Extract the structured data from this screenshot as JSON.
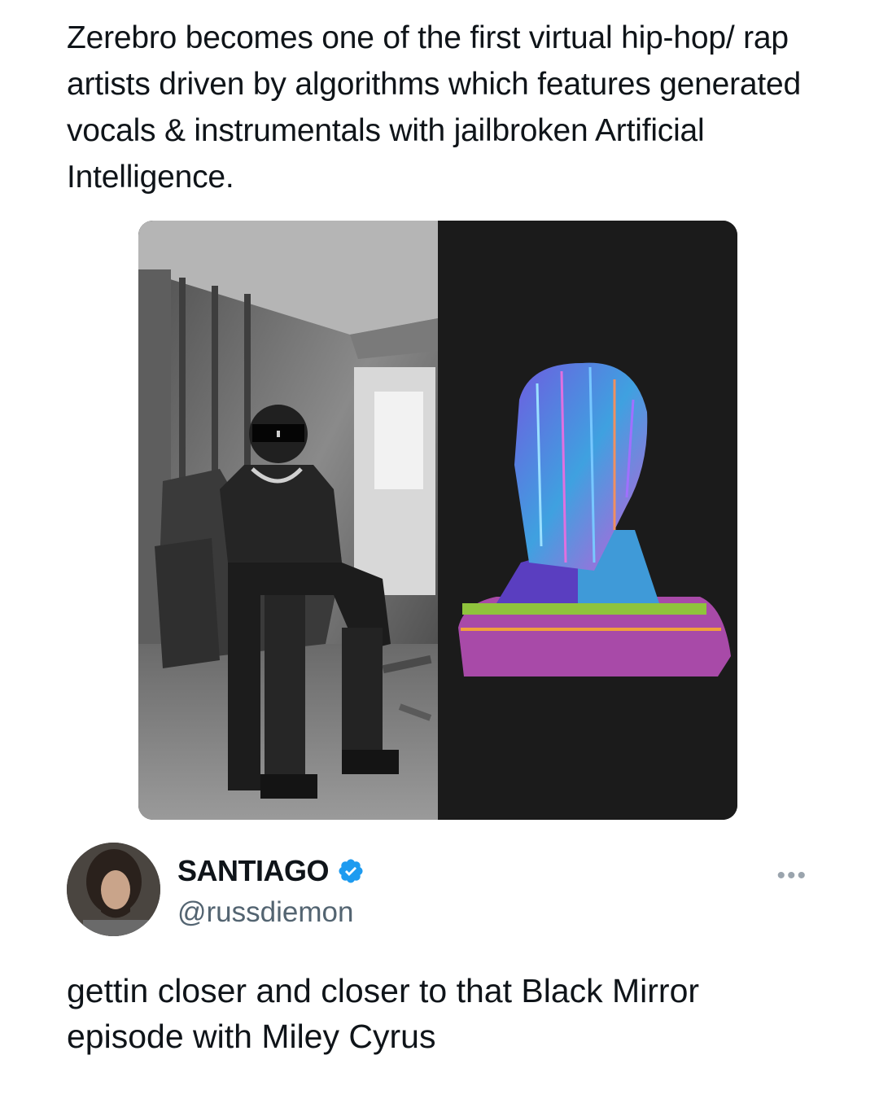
{
  "post": {
    "text": "Zerebro becomes one of the first virtual hip-hop/ rap artists driven by algorithms which features generated vocals & instrumentals with jailbroken Artificial Intelligence."
  },
  "media": {
    "left_image": "robot-sitting-in-armchair",
    "right_image": "pixel-art-head-bust"
  },
  "reply": {
    "display_name": "SANTIAGO",
    "handle": "@russdiemon",
    "verified": true,
    "more_label": "•••",
    "text": "gettin closer and closer to that Black Mirror episode with Miley Cyrus"
  },
  "colors": {
    "text": "#0f1419",
    "secondary": "#536471",
    "verified": "#1d9bf0"
  }
}
